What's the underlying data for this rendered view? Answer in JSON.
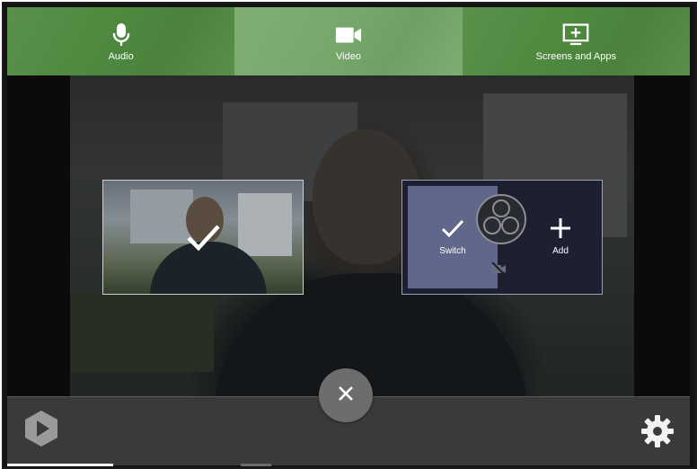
{
  "tabs": [
    {
      "label": "Audio",
      "icon": "microphone-icon",
      "active": false
    },
    {
      "label": "Video",
      "icon": "video-camera-icon",
      "active": true
    },
    {
      "label": "Screens and Apps",
      "icon": "screen-add-icon",
      "active": false
    }
  ],
  "sources": {
    "webcam": {
      "selected": true,
      "icon": "checkmark-icon"
    },
    "obs": {
      "switch_label": "Switch",
      "add_label": "Add",
      "icon": "obs-logo-icon",
      "camera_status_icon": "camera-off-icon"
    }
  },
  "bottom": {
    "close_icon": "close-icon",
    "app_logo": "app-logo-icon",
    "settings_icon": "gear-icon"
  },
  "colors": {
    "tab_bar": "#4f8a40",
    "tab_active": "#77a96c",
    "bottom_bar": "#3a3a3a",
    "switch_pane": "#60678a"
  }
}
